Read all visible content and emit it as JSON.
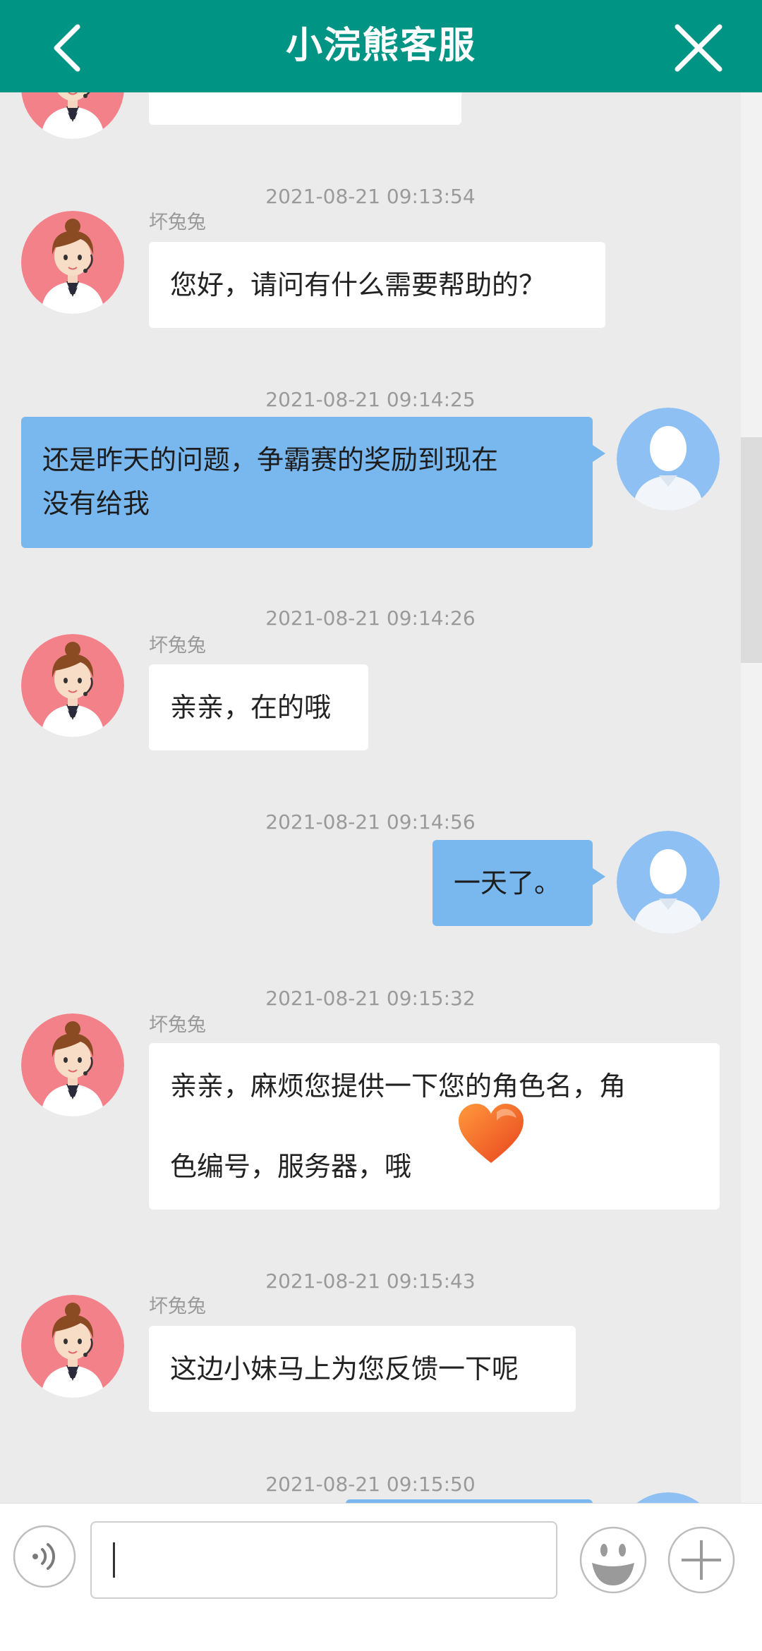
{
  "header": {
    "title": "小浣熊客服",
    "back_icon": "chevron-left-icon",
    "close_icon": "close-icon",
    "color": "#009485"
  },
  "agent_name": "坏兔兔",
  "messages": [
    {
      "from": "agent",
      "timestamp": "2021-08-21 09:13:54",
      "sender": "坏兔兔",
      "lines": [
        "您好，请问有什么需要帮助的？"
      ]
    },
    {
      "from": "user",
      "timestamp": "2021-08-21 09:14:25",
      "lines": [
        "还是昨天的问题，争霸赛的奖励到现在",
        "没有给我"
      ]
    },
    {
      "from": "agent",
      "timestamp": "2021-08-21 09:14:26",
      "sender": "坏兔兔",
      "lines": [
        "亲亲，在的哦"
      ]
    },
    {
      "from": "user",
      "timestamp": "2021-08-21 09:14:56",
      "lines": [
        "一天了。"
      ]
    },
    {
      "from": "agent",
      "timestamp": "2021-08-21 09:15:32",
      "sender": "坏兔兔",
      "lines": [
        "亲亲，麻烦您提供一下您的角色名，角",
        "色编号，服务器，哦"
      ],
      "emoji": "heart-icon"
    },
    {
      "from": "agent",
      "timestamp": "2021-08-21 09:15:43",
      "sender": "坏兔兔",
      "lines": [
        "这边小妹马上为您反馈一下呢"
      ]
    },
    {
      "from": "user",
      "timestamp": "2021-08-21 09:15:50",
      "lines": []
    }
  ],
  "input": {
    "value": "",
    "placeholder": ""
  },
  "toolbar": {
    "voice_icon": "voice-icon",
    "emoji_icon": "emoji-icon",
    "plus_icon": "plus-icon"
  }
}
